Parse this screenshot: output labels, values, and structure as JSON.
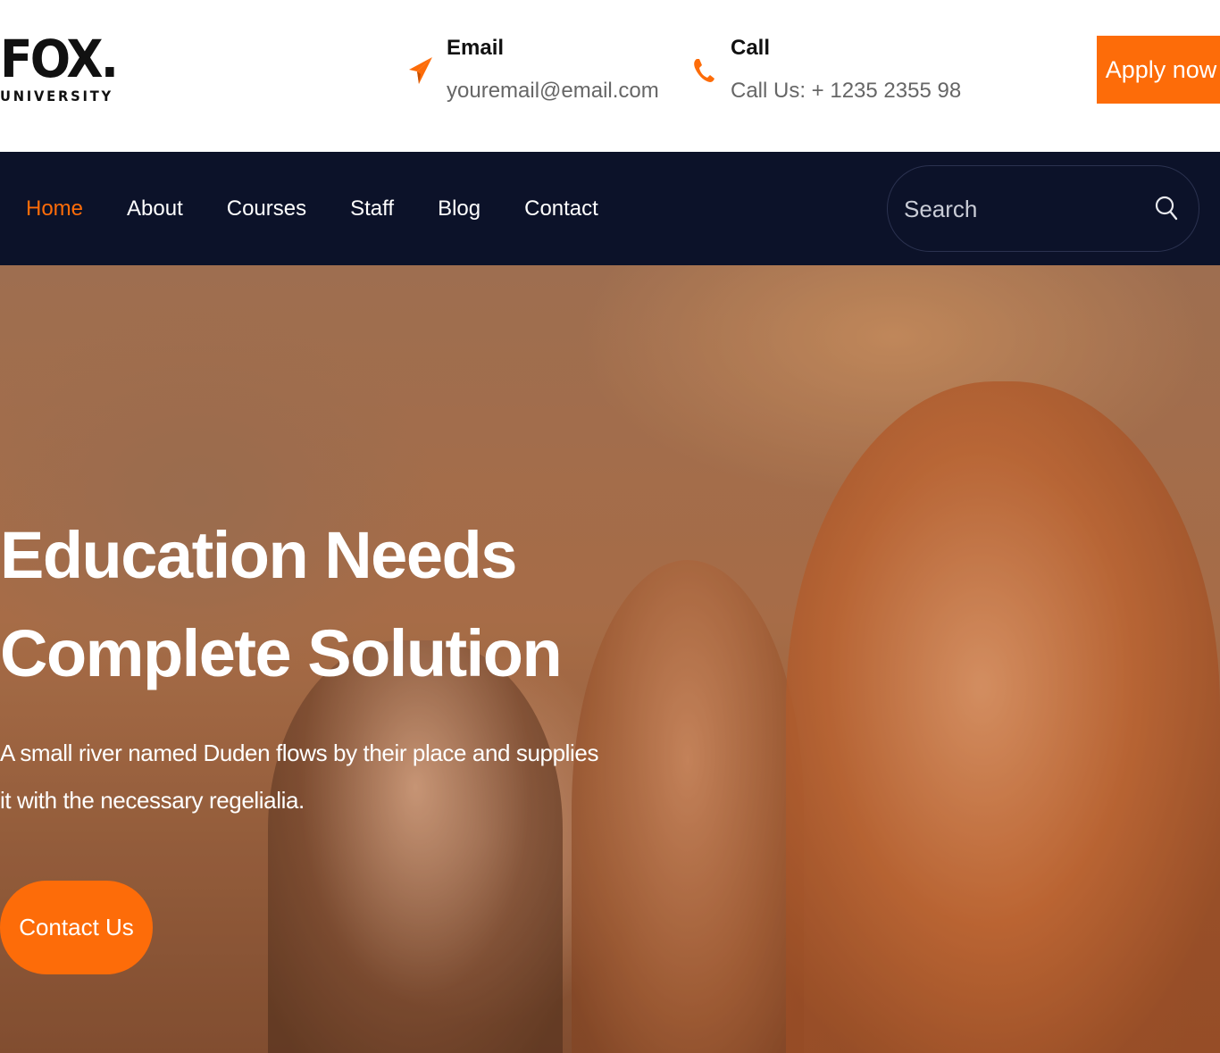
{
  "brand": {
    "name": "FOX.",
    "subtitle": "UNIVERSITY"
  },
  "header": {
    "email": {
      "label": "Email",
      "value": "youremail@email.com",
      "icon": "paper-plane-icon"
    },
    "call": {
      "label": "Call",
      "value": "Call Us: + 1235 2355 98",
      "icon": "phone-icon"
    },
    "apply_label": "Apply now"
  },
  "nav": {
    "items": [
      {
        "label": "Home",
        "active": true
      },
      {
        "label": "About",
        "active": false
      },
      {
        "label": "Courses",
        "active": false
      },
      {
        "label": "Staff",
        "active": false
      },
      {
        "label": "Blog",
        "active": false
      },
      {
        "label": "Contact",
        "active": false
      }
    ],
    "search_placeholder": "Search",
    "search_icon": "search-icon"
  },
  "hero": {
    "title_line1": "Education Needs",
    "title_line2": "Complete Solution",
    "text": "A small river named Duden flows by their place and supplies it with the necessary regelialia.",
    "button_label": "Contact Us"
  },
  "colors": {
    "accent": "#fd6c09",
    "nav_bg": "#0c1229",
    "text_dark": "#111111",
    "text_muted": "#666666"
  }
}
